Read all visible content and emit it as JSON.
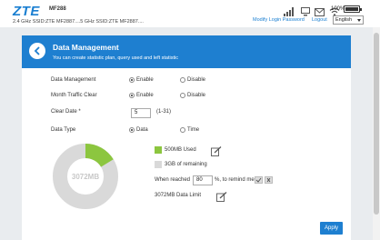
{
  "brand": {
    "logo": "ZTE",
    "model": "MF288"
  },
  "ssid": {
    "text": "2.4 GHz SSID:ZTE MF2887....5 GHz SSID:ZTE MF2887...."
  },
  "battery": {
    "percent_text": "100%",
    "level": 1.0
  },
  "top_links": {
    "modify_password": "Modify Login Password",
    "logout": "Logout"
  },
  "language": {
    "selected": "English"
  },
  "header": {
    "title": "Data Management",
    "subtitle": "You can create statistic plan, query used and left statistic"
  },
  "form": {
    "data_management": {
      "label": "Data Management",
      "enable": "Enable",
      "disable": "Disable",
      "selected": "enable"
    },
    "month_traffic_clear": {
      "label": "Month Traffic Clear",
      "enable": "Enable",
      "disable": "Disable",
      "selected": "enable"
    },
    "clear_date": {
      "label": "Clear Date *",
      "value": "5",
      "range": "(1-31)"
    },
    "data_type": {
      "label": "Data Type",
      "data": "Data",
      "time": "Time",
      "selected": "data"
    }
  },
  "usage": {
    "center_label": "3072MB",
    "used_fraction": 0.1628,
    "used_label": "500MB Used",
    "remaining_label": "3GB of remaining",
    "remind_prefix": "When reached",
    "remind_value": "80",
    "remind_suffix": "%, to remind me",
    "limit_label": "3072MB Data Limit",
    "colors": {
      "used": "#8cc63f",
      "remaining": "#d9d9d9"
    }
  },
  "apply_label": "Apply",
  "colors": {
    "brand_blue": "#1e7fd0",
    "page_bg": "#e9ecef"
  }
}
